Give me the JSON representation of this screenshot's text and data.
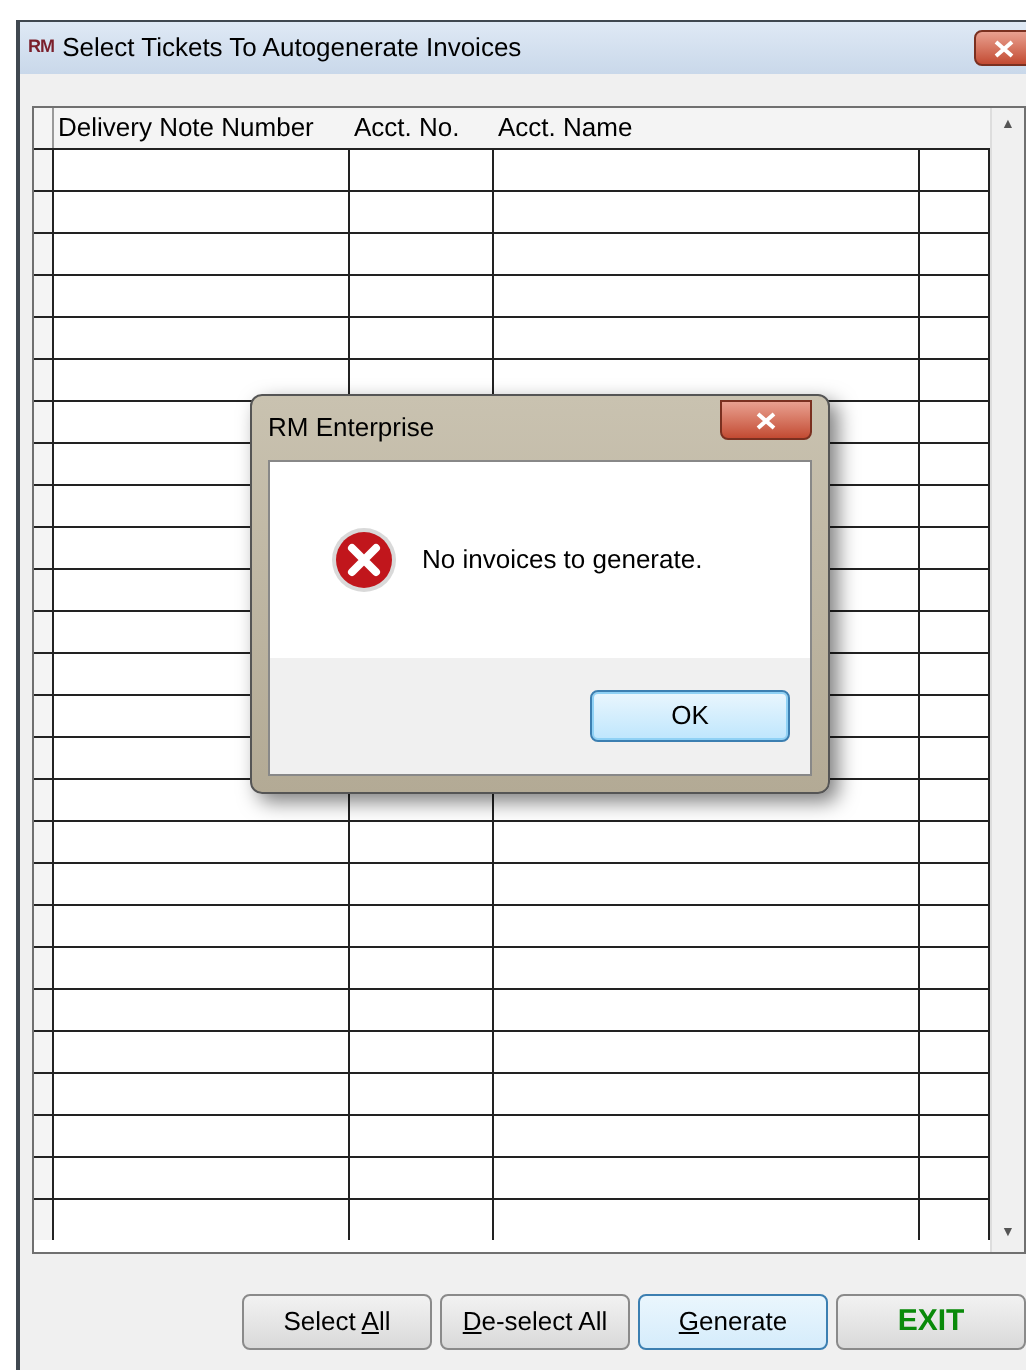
{
  "window": {
    "title": "Select Tickets To Autogenerate Invoices",
    "logo": "RM"
  },
  "table": {
    "columns": [
      {
        "label": "Delivery Note Number"
      },
      {
        "label": "Acct. No."
      },
      {
        "label": "Acct. Name"
      }
    ],
    "scroll_up": "▲",
    "scroll_down": "▼"
  },
  "buttons": [
    {
      "kind": "plain",
      "pre": "Select ",
      "key": "A",
      "post": "ll",
      "focused": false
    },
    {
      "kind": "plain",
      "key": "D",
      "post": "e-select All",
      "focused": false
    },
    {
      "kind": "plain",
      "key": "G",
      "post": "enerate",
      "focused": true
    },
    {
      "kind": "exit",
      "pre": "EXIT",
      "focused": false
    }
  ],
  "dialog": {
    "title": "RM Enterprise",
    "message": "No invoices to generate.",
    "button": "OK"
  }
}
